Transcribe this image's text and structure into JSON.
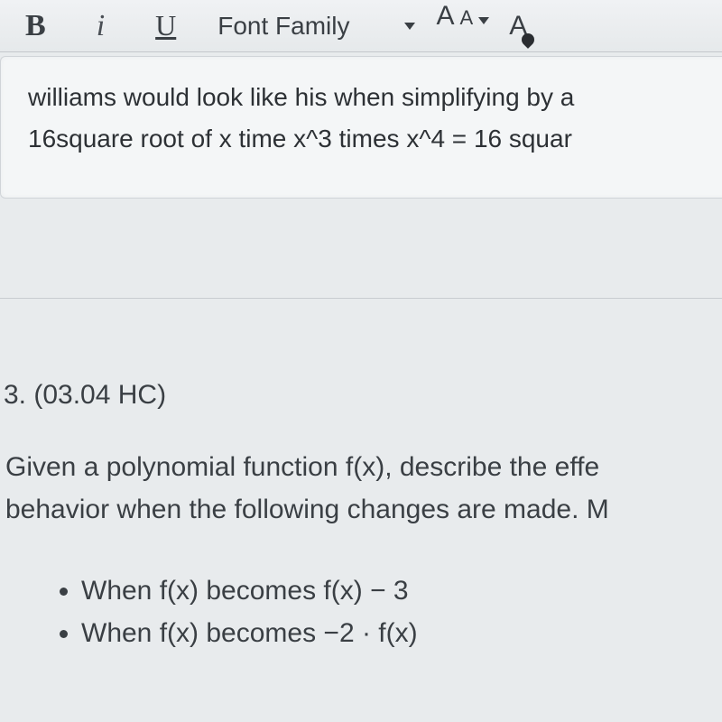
{
  "toolbar": {
    "bold_label": "B",
    "italic_label": "i",
    "underline_label": "U",
    "font_family_label": "Font Family",
    "font_size_large": "A",
    "font_size_small": "A",
    "font_color_label": "A"
  },
  "editor": {
    "line1": "williams would look like his when simplifying by a",
    "line2": "16square root of x time x^3 times x^4 = 16 squar"
  },
  "question": {
    "heading": "3. (03.04 HC)",
    "body_line1": "Given a polynomial function f(x), describe the effe",
    "body_line2": "behavior when the following changes are made. M",
    "bullets": [
      "When f(x) becomes f(x) − 3",
      "When f(x) becomes −2 · f(x)"
    ]
  }
}
